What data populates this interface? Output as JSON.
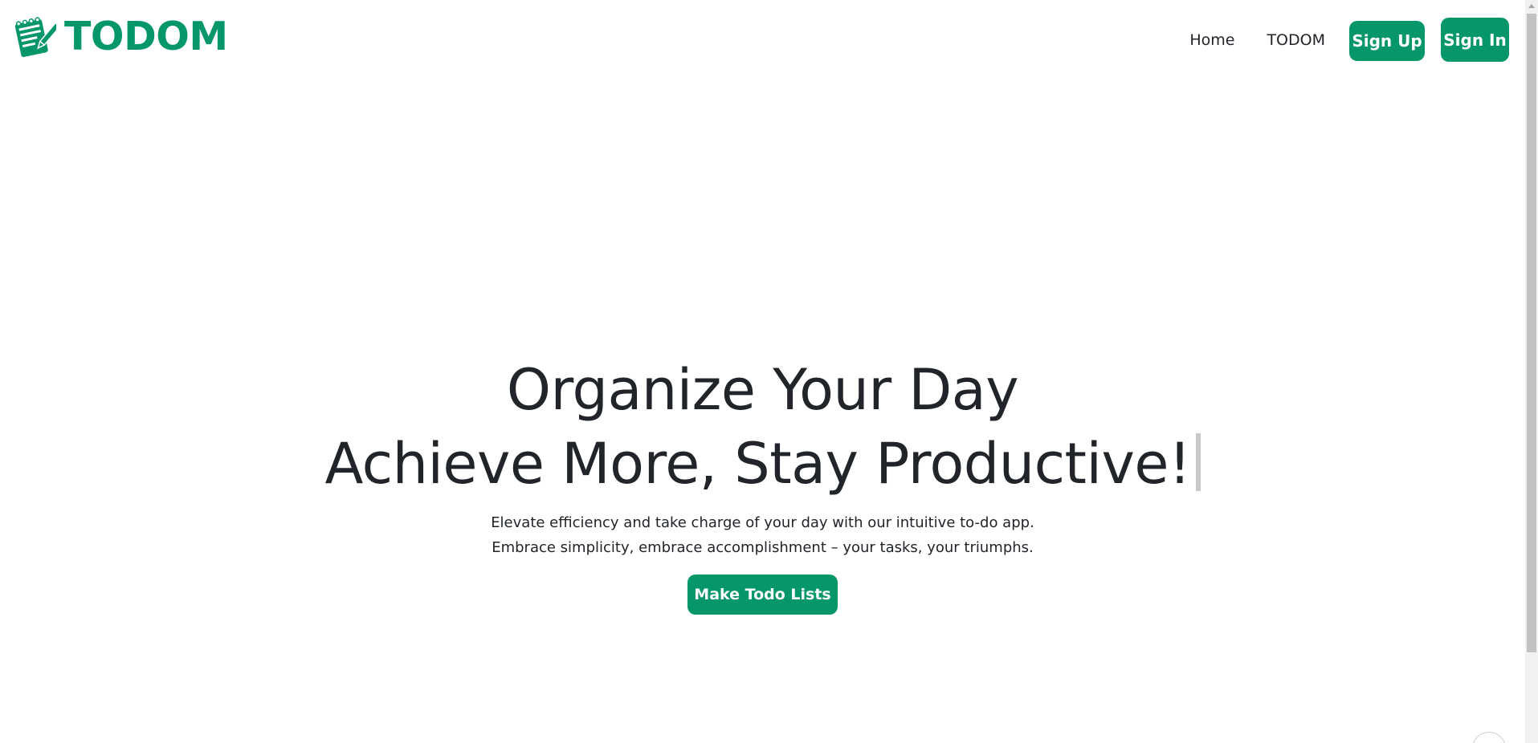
{
  "brand": {
    "name": "TODOM",
    "icon": "notepad-pencil-icon",
    "color": "#059669"
  },
  "nav": {
    "links": [
      "Home",
      "TODOM"
    ],
    "signup_label": "Sign Up",
    "signin_label": "Sign In"
  },
  "hero": {
    "title_line1": "Organize Your Day",
    "title_line2": "Achieve More, Stay Productive!",
    "subtitle_line1": "Elevate efficiency and take charge of your day with our intuitive to-do app.",
    "subtitle_line2": "Embrace simplicity, embrace accomplishment – your tasks, your triumphs.",
    "cta_label": "Make Todo Lists"
  },
  "colors": {
    "accent": "#059669",
    "text": "#212529"
  }
}
